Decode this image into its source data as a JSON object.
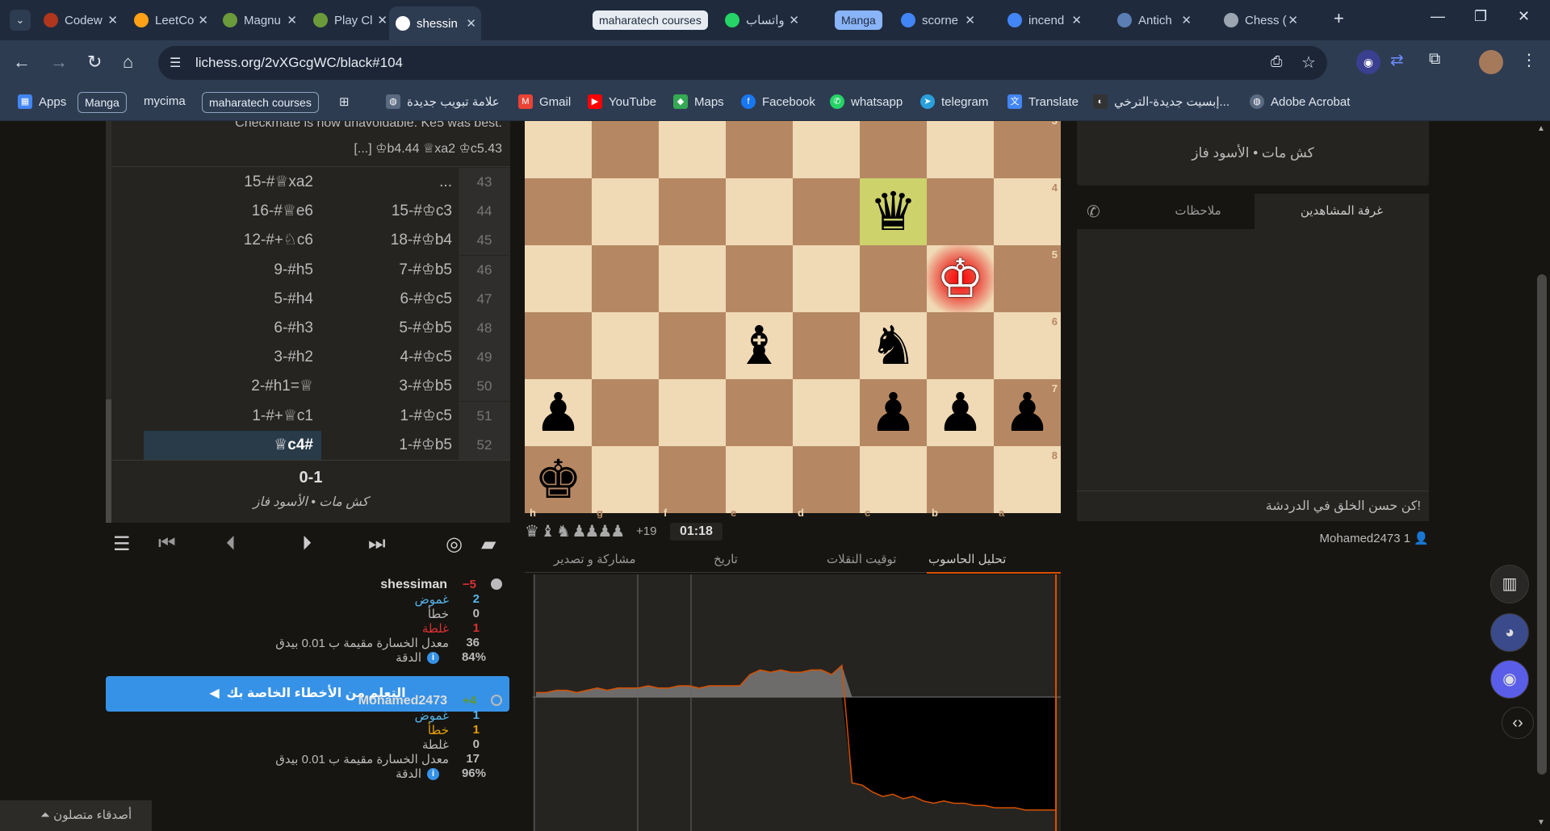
{
  "browser": {
    "tabs": [
      {
        "title": "Codew",
        "icon": "codewars-icon",
        "color": "#b1361e"
      },
      {
        "title": "LeetCo",
        "icon": "leetcode-icon",
        "color": "#ffa116"
      },
      {
        "title": "Magnu",
        "icon": "chess-pawn-icon",
        "color": "#6b9a3b"
      },
      {
        "title": "Play Cl",
        "icon": "chesscom-icon",
        "color": "#6b9a3b"
      },
      {
        "title": "shessin",
        "icon": "lichess-icon",
        "color": "#ffffff"
      },
      {
        "title": "واتساب",
        "icon": "whatsapp-icon",
        "color": "#25d366"
      },
      {
        "title": "scorne",
        "icon": "google-icon",
        "color": "#4285f4"
      },
      {
        "title": "incend",
        "icon": "google-icon",
        "color": "#4285f4"
      },
      {
        "title": "Antich",
        "icon": "globe-icon",
        "color": "#5b7fb5"
      },
      {
        "title": "Chess (",
        "icon": "globe-icon",
        "color": "#9aa5b1"
      }
    ],
    "tab_pill_1": "maharatech courses",
    "tab_pill_2": "Manga",
    "url": "lichess.org/2vXGcgWC/black#104",
    "bookmarks": {
      "apps": "Apps",
      "manga": "Manga",
      "mycima": "mycima",
      "maharatech": "maharatech courses",
      "new_tab": "علامة تبويب جديدة",
      "gmail": "Gmail",
      "youtube": "YouTube",
      "maps": "Maps",
      "facebook": "Facebook",
      "whatsapp": "whatsapp",
      "telegram": "telegram",
      "translate": "Translate",
      "episode": "إبسيت جديدة-الترخي...",
      "acrobat": "Adobe Acrobat"
    }
  },
  "analysis": {
    "comment_top": "Checkmate is now unavoidable. Ke5 was best.",
    "comment_line": "[...] ♔b4.44 ♕xa2 ♔c5.43",
    "moves": [
      {
        "num": "43",
        "white": "...",
        "black": "15-#♕xa2"
      },
      {
        "num": "44",
        "white": "15-#♔c3",
        "black": "16-#♕e6"
      },
      {
        "num": "45",
        "white": "18-#♔b4",
        "black": "12-#+♘c6"
      },
      {
        "num": "46",
        "white": "7-#♔b5",
        "black": "9-#h5"
      },
      {
        "num": "47",
        "white": "6-#♔c5",
        "black": "5-#h4"
      },
      {
        "num": "48",
        "white": "5-#♔b5",
        "black": "6-#h3"
      },
      {
        "num": "49",
        "white": "4-#♔c5",
        "black": "3-#h2"
      },
      {
        "num": "50",
        "white": "3-#♔b5",
        "black": "2-#h1=♕"
      },
      {
        "num": "51",
        "white": "1-#♔c5",
        "black": "1-#+♕c1"
      },
      {
        "num": "52",
        "white": "1-#♔b5",
        "black": "♕c4#"
      }
    ],
    "result": "0-1",
    "result_text": "كش مات • الأسود فاز",
    "players": [
      {
        "name": "shessiman",
        "diff": "−5",
        "inaccuracy_count": "2",
        "inaccuracy_label": "غموض",
        "mistake_count": "0",
        "mistake_label": "خطأ",
        "blunder_count": "1",
        "blunder_label": "غلطة",
        "acpl_value": "36",
        "acpl_label": "معدل الخسارة مقيمة ب 0.01 بيدق",
        "accuracy_value": "84%",
        "accuracy_label": "الدقة"
      },
      {
        "name": "Mohamed2473",
        "diff": "+4",
        "inaccuracy_count": "1",
        "inaccuracy_label": "غموض",
        "mistake_count": "1",
        "mistake_label": "خطأ",
        "blunder_count": "0",
        "blunder_label": "غلطة",
        "acpl_value": "17",
        "acpl_label": "معدل الخسارة مقيمة ب 0.01 بيدق",
        "accuracy_value": "96%",
        "accuracy_label": "الدقة"
      }
    ],
    "learn_button": "التعلم من الأخطاء الخاصة بك",
    "friends": "أصدقاء متصلون"
  },
  "board": {
    "files": [
      "h",
      "g",
      "f",
      "e",
      "d",
      "c",
      "b",
      "a"
    ],
    "ranks": [
      "3",
      "4",
      "5",
      "6",
      "7",
      "8"
    ],
    "material_plus": "+19",
    "clock": "01:18",
    "highlight_color": "#cdd26a",
    "check_color": "#ff0000",
    "pieces": [
      {
        "square": "c4",
        "glyph": "♛",
        "name": "black-queen"
      },
      {
        "square": "b5",
        "glyph": "♔",
        "name": "white-king"
      },
      {
        "square": "e6",
        "glyph": "♝",
        "name": "black-bishop"
      },
      {
        "square": "c6",
        "glyph": "♞",
        "name": "black-knight"
      },
      {
        "square": "h7",
        "glyph": "♟",
        "name": "black-pawn"
      },
      {
        "square": "c7",
        "glyph": "♟",
        "name": "black-pawn"
      },
      {
        "square": "b7",
        "glyph": "♟",
        "name": "black-pawn"
      },
      {
        "square": "a7",
        "glyph": "♟",
        "name": "black-pawn"
      },
      {
        "square": "h8",
        "glyph": "♚",
        "name": "black-king"
      }
    ]
  },
  "bottom_tabs": [
    "تحليل الحاسوب",
    "توقيت النقلات",
    "تاريخ",
    "مشاركة و تصدير"
  ],
  "chat": {
    "result_text": "كش مات • الأسود فاز",
    "tab_spectators": "غرفة المشاهدين",
    "tab_notes": "ملاحظات",
    "placeholder": "كن حسن الخلق في الدردشة!",
    "spectators": "Mohamed2473 1"
  },
  "graph": {
    "advantage_series": [
      0.2,
      0.2,
      0.3,
      0.3,
      0.2,
      0.3,
      0.4,
      0.3,
      0.4,
      0.4,
      0.4,
      0.5,
      0.4,
      0.4,
      0.5,
      0.5,
      0.4,
      0.5,
      0.5,
      0.5,
      0.5,
      1.0,
      1.2,
      1.1,
      1.2,
      1.1,
      1.1,
      1.2,
      1.2,
      1.0,
      1.4,
      -3.8,
      -3.9,
      -4.2,
      -4.4,
      -4.3,
      -4.5,
      -4.4,
      -4.6,
      -4.7,
      -4.6,
      -4.7,
      -4.7,
      -4.8,
      -4.8,
      -4.9,
      -4.9,
      -4.9,
      -5.0,
      -5.0,
      -5.0,
      -5.0
    ],
    "line_color": "#d85000",
    "white_fill": "#6e6c6a",
    "black_fill": "#000000"
  }
}
